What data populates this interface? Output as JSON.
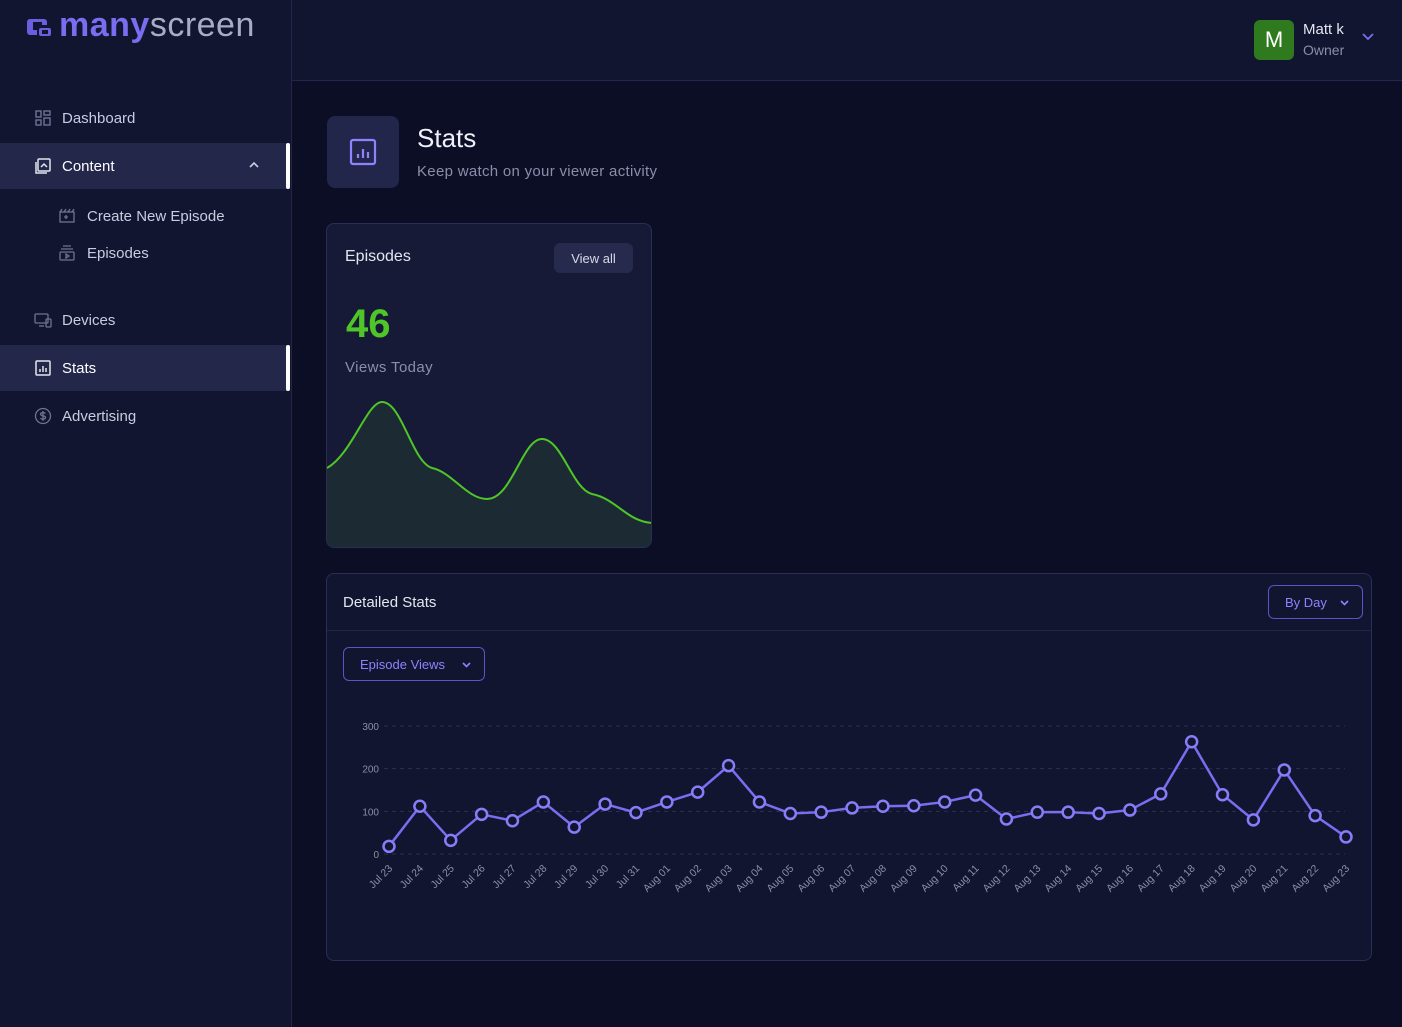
{
  "brand": {
    "name_bold": "many",
    "name_light": "screen"
  },
  "sidebar": {
    "items": [
      {
        "label": "Dashboard",
        "icon": "dashboard-icon"
      },
      {
        "label": "Content",
        "icon": "content-icon"
      },
      {
        "label": "Devices",
        "icon": "devices-icon"
      },
      {
        "label": "Stats",
        "icon": "stats-icon"
      },
      {
        "label": "Advertising",
        "icon": "dollar-icon"
      }
    ],
    "content_sub": [
      {
        "label": "Create New Episode",
        "icon": "clapper-icon"
      },
      {
        "label": "Episodes",
        "icon": "episodes-icon"
      }
    ]
  },
  "user": {
    "initial": "M",
    "name": "Matt k",
    "role": "Owner"
  },
  "page": {
    "title": "Stats",
    "subtitle": "Keep watch on your viewer activity"
  },
  "episodes_card": {
    "title": "Episodes",
    "view_all": "View all",
    "value": "46",
    "label": "Views Today"
  },
  "detailed": {
    "title": "Detailed Stats",
    "period": "By Day",
    "metric": "Episode Views"
  },
  "colors": {
    "accent": "#7b6cf0",
    "green": "#4fc627",
    "bg": "#0b0e25",
    "panel": "#12152f"
  },
  "chart_data": {
    "type": "line",
    "categories": [
      "Jul 23",
      "Jul 24",
      "Jul 25",
      "Jul 26",
      "Jul 27",
      "Jul 28",
      "Jul 29",
      "Jul 30",
      "Jul 31",
      "Aug 01",
      "Aug 02",
      "Aug 03",
      "Aug 04",
      "Aug 05",
      "Aug 06",
      "Aug 07",
      "Aug 08",
      "Aug 09",
      "Aug 10",
      "Aug 11",
      "Aug 12",
      "Aug 13",
      "Aug 14",
      "Aug 15",
      "Aug 16",
      "Aug 17",
      "Aug 18",
      "Aug 19",
      "Aug 20",
      "Aug 21",
      "Aug 22",
      "Aug 23"
    ],
    "values": [
      18,
      112,
      32,
      93,
      78,
      122,
      63,
      117,
      97,
      122,
      145,
      207,
      122,
      95,
      98,
      108,
      112,
      113,
      122,
      138,
      82,
      98,
      98,
      95,
      103,
      141,
      263,
      139,
      80,
      197,
      90,
      40
    ],
    "yticks": [
      0,
      100,
      200,
      300
    ],
    "ylim": [
      0,
      300
    ],
    "grid": true
  }
}
